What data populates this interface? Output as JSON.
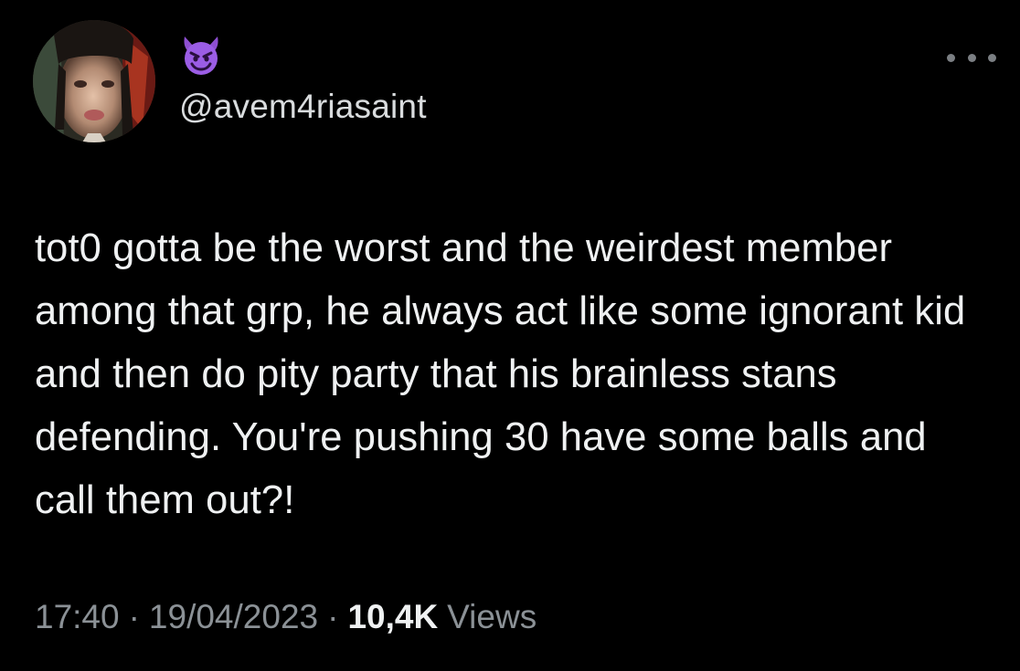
{
  "tweet": {
    "author_emoji": "smiling-face-with-horns",
    "handle": "@avem4riasaint",
    "text": "tot0 gotta be the worst and the weirdest member among that grp, he always act like some ignorant kid and then do pity party that his brainless stans defending. You're pushing 30 have some balls and call them out?!",
    "time": "17:40",
    "separator": "·",
    "date": "19/04/2023",
    "views_count": "10,4K",
    "views_label": "Views"
  },
  "colors": {
    "background": "#000000",
    "text_primary": "#eff1f2",
    "text_secondary": "#8b9196",
    "emoji_purple": "#8e4fd1"
  }
}
